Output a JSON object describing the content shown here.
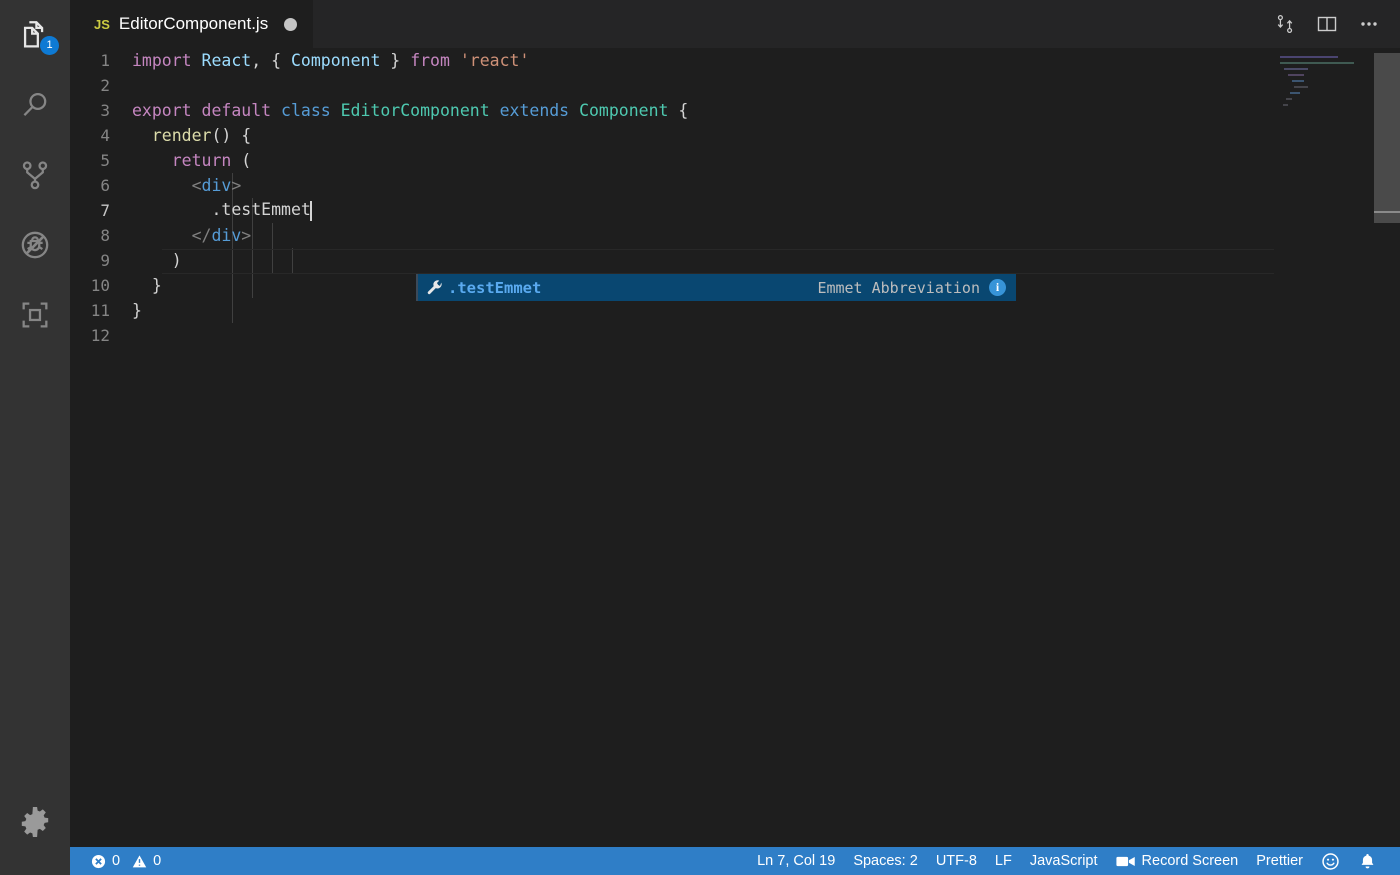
{
  "window": {
    "theme_bg": "#1e1e1e",
    "activity_bar_bg": "#333333",
    "status_bar_bg": "#2f7ec7",
    "accent": "#0e7ad4"
  },
  "activity_bar": {
    "items": [
      {
        "name": "explorer",
        "icon": "files-icon",
        "badge": "1"
      },
      {
        "name": "search",
        "icon": "search-icon",
        "badge": ""
      },
      {
        "name": "source-control",
        "icon": "source-control-icon",
        "badge": ""
      },
      {
        "name": "run-and-debug",
        "icon": "run-debug-icon",
        "badge": ""
      },
      {
        "name": "extensions",
        "icon": "extensions-icon",
        "badge": ""
      }
    ],
    "manage": {
      "name": "manage",
      "icon": "gear-icon"
    }
  },
  "tab": {
    "extension_label": "JS",
    "filename": "EditorComponent.js",
    "dirty": true
  },
  "editor_actions": [
    {
      "name": "compare-changes",
      "icon": "compare-icon"
    },
    {
      "name": "split-editor",
      "icon": "split-editor-icon"
    },
    {
      "name": "more-actions",
      "icon": "ellipsis-icon"
    }
  ],
  "editor": {
    "language": "JavaScript",
    "cursor_line": 7,
    "lines": [
      {
        "number": "1",
        "tokens": [
          {
            "text": "import ",
            "cls": "t-key"
          },
          {
            "text": "React",
            "cls": "t-var"
          },
          {
            "text": ", { ",
            "cls": "t-plain"
          },
          {
            "text": "Component",
            "cls": "t-var"
          },
          {
            "text": " } ",
            "cls": "t-plain"
          },
          {
            "text": "from ",
            "cls": "t-key"
          },
          {
            "text": "'react'",
            "cls": "t-str"
          }
        ]
      },
      {
        "number": "2",
        "tokens": []
      },
      {
        "number": "3",
        "tokens": [
          {
            "text": "export default ",
            "cls": "t-key"
          },
          {
            "text": "class ",
            "cls": "t-ctrl"
          },
          {
            "text": "EditorComponent ",
            "cls": "t-type"
          },
          {
            "text": "extends ",
            "cls": "t-ctrl"
          },
          {
            "text": "Component",
            "cls": "t-type"
          },
          {
            "text": " {",
            "cls": "t-plain"
          }
        ]
      },
      {
        "number": "4",
        "tokens": [
          {
            "text": "  ",
            "cls": "t-plain"
          },
          {
            "text": "render",
            "cls": "t-fn"
          },
          {
            "text": "() {",
            "cls": "t-plain"
          }
        ]
      },
      {
        "number": "5",
        "tokens": [
          {
            "text": "    ",
            "cls": "t-plain"
          },
          {
            "text": "return",
            "cls": "t-key"
          },
          {
            "text": " (",
            "cls": "t-plain"
          }
        ]
      },
      {
        "number": "6",
        "tokens": [
          {
            "text": "      ",
            "cls": "t-plain"
          },
          {
            "text": "<",
            "cls": "t-brk"
          },
          {
            "text": "div",
            "cls": "t-tag"
          },
          {
            "text": ">",
            "cls": "t-brk"
          }
        ]
      },
      {
        "number": "7",
        "tokens": [
          {
            "text": "        .testEmmet",
            "cls": "t-plain"
          }
        ],
        "cursor": true
      },
      {
        "number": "8",
        "tokens": [
          {
            "text": "      ",
            "cls": "t-plain"
          },
          {
            "text": "</",
            "cls": "t-brk"
          },
          {
            "text": "div",
            "cls": "t-tag"
          },
          {
            "text": ">",
            "cls": "t-brk"
          }
        ]
      },
      {
        "number": "9",
        "tokens": [
          {
            "text": "    )",
            "cls": "t-plain"
          }
        ]
      },
      {
        "number": "10",
        "tokens": [
          {
            "text": "  }",
            "cls": "t-plain"
          }
        ]
      },
      {
        "number": "11",
        "tokens": [
          {
            "text": "}",
            "cls": "t-plain"
          }
        ]
      },
      {
        "number": "12",
        "tokens": []
      }
    ]
  },
  "suggest_widget": {
    "icon": "wrench-icon",
    "label": ".testEmmet",
    "detail": "Emmet Abbreviation",
    "info_badge": "i",
    "selected_bg": "#094771"
  },
  "status_bar": {
    "left": [
      {
        "name": "problems",
        "error_icon": "error-icon",
        "error_count": "0",
        "warning_icon": "warning-icon",
        "warning_count": "0"
      }
    ],
    "right": [
      {
        "name": "editor-position",
        "label": "Ln 7, Col 19",
        "icon": ""
      },
      {
        "name": "indentation",
        "label": "Spaces: 2",
        "icon": ""
      },
      {
        "name": "encoding",
        "label": "UTF-8",
        "icon": ""
      },
      {
        "name": "eol",
        "label": "LF",
        "icon": ""
      },
      {
        "name": "language-mode",
        "label": "JavaScript",
        "icon": ""
      },
      {
        "name": "record-screen",
        "label": "Record Screen",
        "icon": "camera-icon"
      },
      {
        "name": "prettier",
        "label": "Prettier",
        "icon": ""
      },
      {
        "name": "feedback",
        "label": "",
        "icon": "smiley-icon"
      },
      {
        "name": "notifications",
        "label": "",
        "icon": "bell-icon"
      }
    ]
  }
}
